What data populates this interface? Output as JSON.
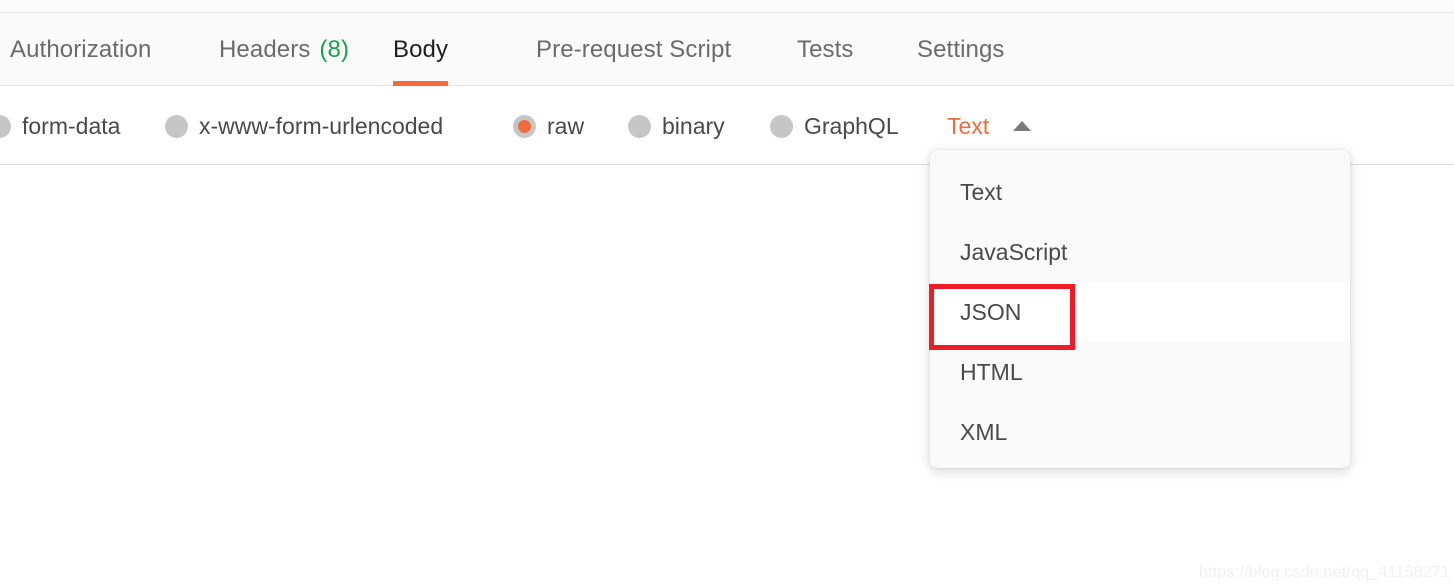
{
  "tabs": [
    {
      "label": "Authorization",
      "active": false
    },
    {
      "label": "Headers",
      "count": "(8)",
      "active": false
    },
    {
      "label": "Body",
      "active": true
    },
    {
      "label": "Pre-request Script",
      "active": false
    },
    {
      "label": "Tests",
      "active": false
    },
    {
      "label": "Settings",
      "active": false
    }
  ],
  "body_modes": [
    {
      "label": "form-data",
      "selected": false
    },
    {
      "label": "x-www-form-urlencoded",
      "selected": false
    },
    {
      "label": "raw",
      "selected": true
    },
    {
      "label": "binary",
      "selected": false
    },
    {
      "label": "GraphQL",
      "selected": false
    }
  ],
  "language_selector": {
    "value": "Text",
    "caret_icon": "chevron-up-icon",
    "expanded": true
  },
  "dropdown": {
    "options": [
      {
        "label": "Text",
        "highlighted": false
      },
      {
        "label": "JavaScript",
        "highlighted": false
      },
      {
        "label": "JSON",
        "highlighted": true
      },
      {
        "label": "HTML",
        "highlighted": false
      },
      {
        "label": "XML",
        "highlighted": false
      }
    ]
  },
  "annotation": {
    "target": "JSON",
    "color": "#ee1c25"
  },
  "colors": {
    "accent": "#ef6c3d",
    "count_green": "#16a34a",
    "annotation_red": "#ee1c25",
    "radio_gray": "#c6c6c6",
    "tabbar_bg": "#fafafa"
  },
  "watermark": {
    "text": "https://blog.csdn.net/qq_41158271"
  }
}
